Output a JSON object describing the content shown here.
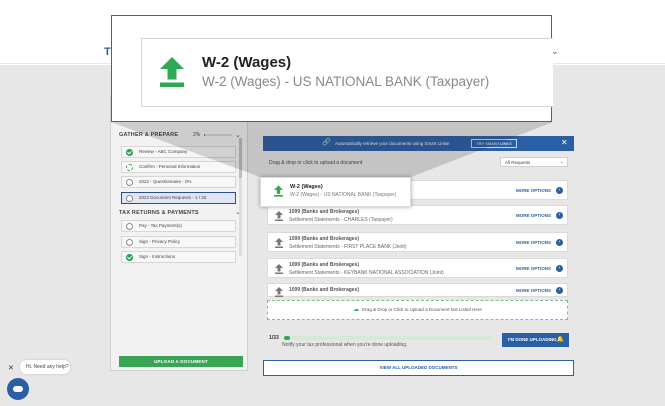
{
  "header": {
    "logo_text": "T",
    "chevron": "⌄"
  },
  "left_panel": {
    "gather_title": "GATHER & PREPARE",
    "gather_progress_pct": "2%",
    "gather_progress_value": 0.02,
    "gather_tasks": [
      {
        "label": "Review - ABC Company",
        "status": "done"
      },
      {
        "label": "Confirm - Personal Information",
        "status": "partial"
      },
      {
        "label": "2022 - Questionnaire - 0%",
        "status": "open"
      },
      {
        "label": "2022 Document Requests - 1 / 33",
        "status": "active"
      }
    ],
    "returns_title": "TAX RETURNS & PAYMENTS",
    "returns_tasks": [
      {
        "label": "Pay - Tax Payment(s)",
        "status": "open"
      },
      {
        "label": "Sign - Privacy Policy",
        "status": "open"
      },
      {
        "label": "Sign - Instructions",
        "status": "done"
      }
    ],
    "upload_button": "UPLOAD A DOCUMENT"
  },
  "smart_links": {
    "text": "Automatically retrieve your documents using Smart Links!",
    "button": "TRY SMART LINKS",
    "close": "✕"
  },
  "upload": {
    "label": "Drag & drop or click to upload a document",
    "filter_selected": "All Requests"
  },
  "documents": [
    {
      "title": "W-2 (Wages)",
      "subtitle": "W-2 (Wages) - US NATIONAL BANK (Taxpayer)",
      "more": "MORE OPTIONS"
    },
    {
      "title": "1099 (Banks and Brokerages)",
      "subtitle": "Settlement Statements - CHARLES (Taxpayer)",
      "more": "MORE OPTIONS"
    },
    {
      "title": "1099 (Banks and Brokerages)",
      "subtitle": "Settlement Statements - FIRST PLACE BANK (Joint)",
      "more": "MORE OPTIONS"
    },
    {
      "title": "1099 (Banks and Brokerages)",
      "subtitle": "Settlement Statements - KEYBANK NATIONAL ASSOCIATION (Joint)",
      "more": "MORE OPTIONS"
    },
    {
      "title": "1099 (Banks and Brokerages)",
      "subtitle": "",
      "more": "MORE OPTIONS"
    }
  ],
  "dropzone_text": "Drag & Drop or Click to Upload a Document Not Listed Here",
  "progress": {
    "count": "1/33",
    "value": 0.0303,
    "notify": "Notify your tax professional when you're done uploading.",
    "done_button": "I'M DONE UPLOADING"
  },
  "view_all": "VIEW ALL UPLOADED DOCUMENTS",
  "chat": {
    "close": "✕",
    "bubble": "Hi. Need any help?"
  },
  "zoom": {
    "title": "W-2 (Wages)",
    "subtitle": "W-2 (Wages) - US NATIONAL BANK (Taxpayer)"
  },
  "colors": {
    "brand_blue": "#2a5ea5",
    "accent_green": "#3aa655",
    "callout_red": "#c0392b"
  }
}
